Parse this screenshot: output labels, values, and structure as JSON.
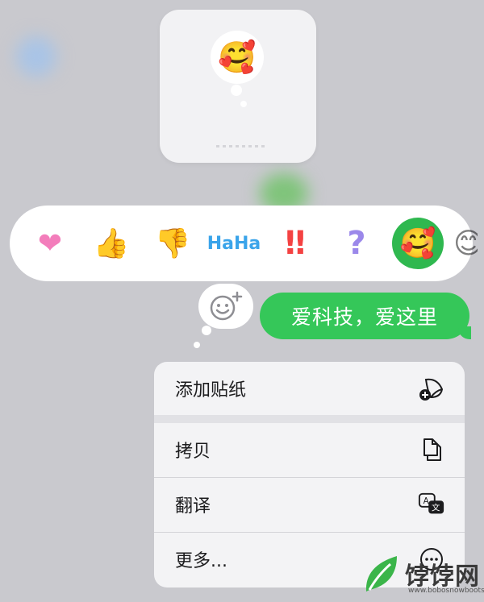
{
  "preview": {
    "emoji": "🥰"
  },
  "tapbacks": [
    {
      "name": "heart",
      "glyph": "❤"
    },
    {
      "name": "thumbs-up",
      "glyph": "👍"
    },
    {
      "name": "thumbs-down",
      "glyph": "👎"
    },
    {
      "name": "haha",
      "glyph": "HaHa"
    },
    {
      "name": "exclamation",
      "glyph": "‼"
    },
    {
      "name": "question",
      "glyph": "?"
    },
    {
      "name": "smiling-hearts",
      "glyph": "🥰",
      "selected": true
    },
    {
      "name": "partial-more",
      "glyph": "😊"
    }
  ],
  "message": {
    "text": "爱科技，爱这里"
  },
  "menu": {
    "items": [
      {
        "label": "添加贴纸",
        "icon": "add-sticker-icon"
      },
      {
        "label": "拷贝",
        "icon": "copy-icon"
      },
      {
        "label": "翻译",
        "icon": "translate-icon"
      },
      {
        "label": "更多...",
        "icon": "more-icon"
      }
    ]
  },
  "watermark": {
    "text": "饽饽网",
    "url": "www.bobosnowboots.com"
  },
  "colors": {
    "accent_green": "#35c759",
    "background": "#c9c9ce"
  }
}
